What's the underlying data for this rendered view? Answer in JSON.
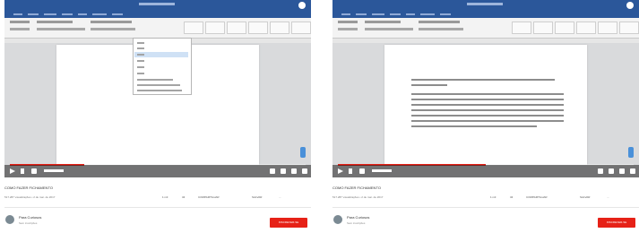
{
  "panels": [
    {
      "video": {
        "progress": 0.25,
        "state": "dropdown-open"
      },
      "title": "COMO FAZER FICHAMENTO",
      "views": "517.287 visualizações • 2 de mar. de 2017",
      "actions": {
        "like": "1 mil",
        "dislike": "34",
        "share": "COMPARTILHAR",
        "save": "SALVAR",
        "more": "..."
      },
      "channel": {
        "name": "Para Curiosos",
        "subs": "Sem inscrições"
      },
      "subscribe": "INSCREVER-SE"
    },
    {
      "video": {
        "progress": 0.5,
        "state": "document-text"
      },
      "title": "COMO FAZER FICHAMENTO",
      "views": "517.287 visualizações • 2 de mar. de 2017",
      "actions": {
        "like": "1 mil",
        "dislike": "34",
        "share": "COMPARTILHAR",
        "save": "SALVAR",
        "more": "..."
      },
      "channel": {
        "name": "Para Curiosos",
        "subs": "Sem inscrições"
      },
      "subscribe": "INSCREVER-SE"
    }
  ],
  "colors": {
    "word_blue": "#2b579a",
    "youtube_red": "#e62117"
  },
  "icons": [
    "play-icon",
    "next-icon",
    "volume-icon",
    "settings-icon",
    "fullscreen-icon",
    "like-icon",
    "dislike-icon",
    "share-icon",
    "save-icon",
    "more-icon"
  ]
}
